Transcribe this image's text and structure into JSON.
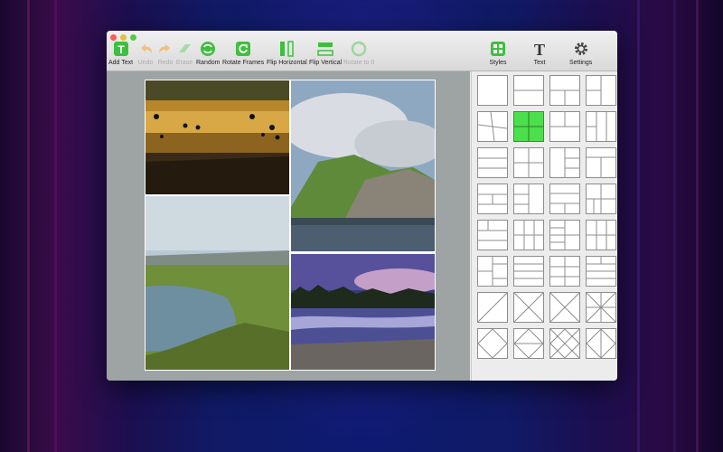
{
  "toolbar": {
    "add_text": "Add Text",
    "undo": "Undo",
    "redo": "Redo",
    "erase": "Erase",
    "random": "Random",
    "rotate_frames": "Rotate Frames",
    "flip_horizontal": "Flip Horizontal",
    "flip_vertical": "Flip Vertical",
    "rotate_to_0": "Rotate to 0",
    "styles": "Styles",
    "text": "Text",
    "settings": "Settings"
  },
  "colors": {
    "accent": "#3fbf3f",
    "selected_tile": "#4be04b",
    "canvas_bg": "#9ea3a3"
  },
  "layouts": {
    "count": 32,
    "selected_index": 5
  }
}
